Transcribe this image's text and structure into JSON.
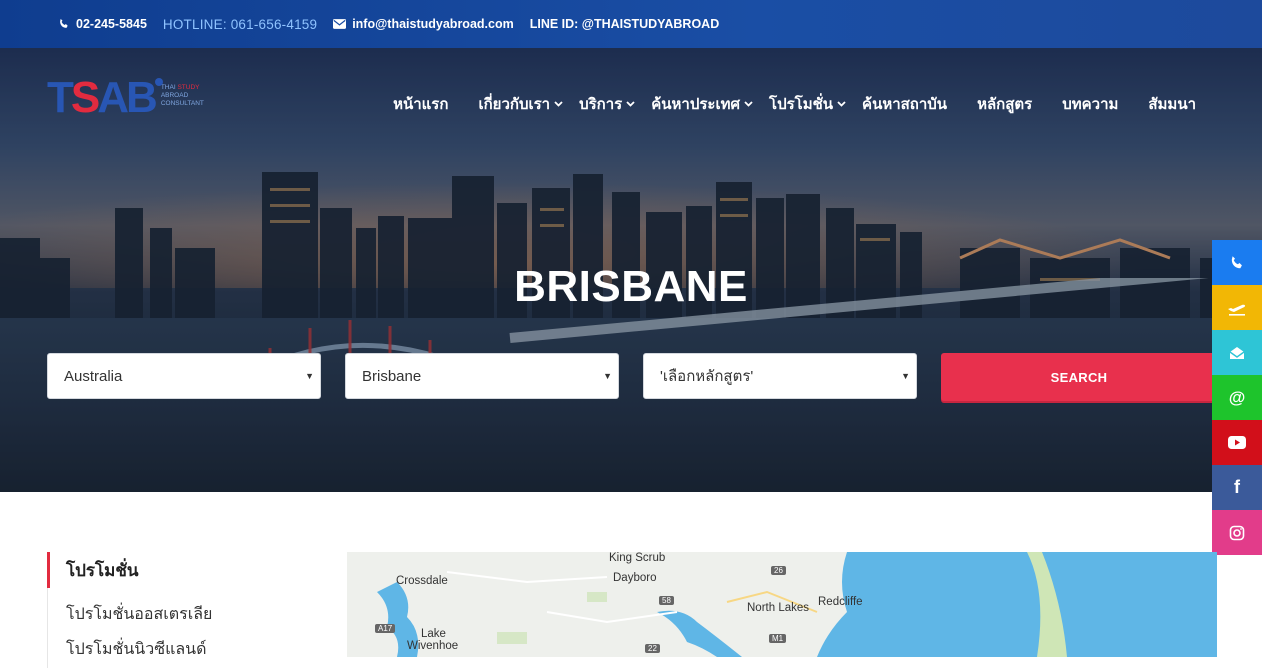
{
  "topbar": {
    "phone": "02-245-5845",
    "hotline": "HOTLINE: 061-656-4159",
    "email": "info@thaistudyabroad.com",
    "line_id": "LINE ID: @THAISTUDYABROAD"
  },
  "logo": {
    "mark_t": "T",
    "mark_s": "S",
    "mark_ab": "AB",
    "tag_line1_a": "THAI ",
    "tag_line1_b": "STUDY",
    "tag_line2": "ABROAD",
    "tag_line3": "CONSULTANT"
  },
  "nav": {
    "items": [
      {
        "label": "หน้าแรก"
      },
      {
        "label": "เกี่ยวกับเรา"
      },
      {
        "label": "บริการ"
      },
      {
        "label": "ค้นหาประเทศ"
      },
      {
        "label": "โปรโมชั่น"
      },
      {
        "label": "ค้นหาสถาบัน"
      },
      {
        "label": "หลักสูตร"
      },
      {
        "label": "บทความ"
      },
      {
        "label": "สัมมนา"
      }
    ]
  },
  "hero": {
    "title": "BRISBANE"
  },
  "search": {
    "country": "Australia",
    "city": "Brisbane",
    "course": "'เลือกหลักสูตร'",
    "button": "SEARCH"
  },
  "social": {
    "colors": [
      "#1a7cf0",
      "#f2b705",
      "#2ec5d6",
      "#1ec42c",
      "#d20f1a",
      "#3b5a9a",
      "#e23c8a"
    ],
    "icons": [
      "phone-icon",
      "plane-icon",
      "envelope-open-icon",
      "at-icon",
      "youtube-icon",
      "facebook-icon",
      "instagram-icon"
    ]
  },
  "sidebar": {
    "heading": "โปรโมชั่น",
    "links": [
      "โปรโมชั่นออสเตรเลีย",
      "โปรโมชั่นนิวซีแลนด์"
    ]
  },
  "map": {
    "labels": [
      "King Scrub",
      "Dayboro",
      "Crossdale",
      "North Lakes",
      "Redcliffe",
      "Lake",
      "Wivenhoe"
    ],
    "roads": [
      "26",
      "58",
      "A17",
      "M1",
      "22"
    ]
  },
  "colors": {
    "brand_blue": "#1a4ea5",
    "accent_red": "#e8304d",
    "hotline": "#8fc3ff"
  }
}
